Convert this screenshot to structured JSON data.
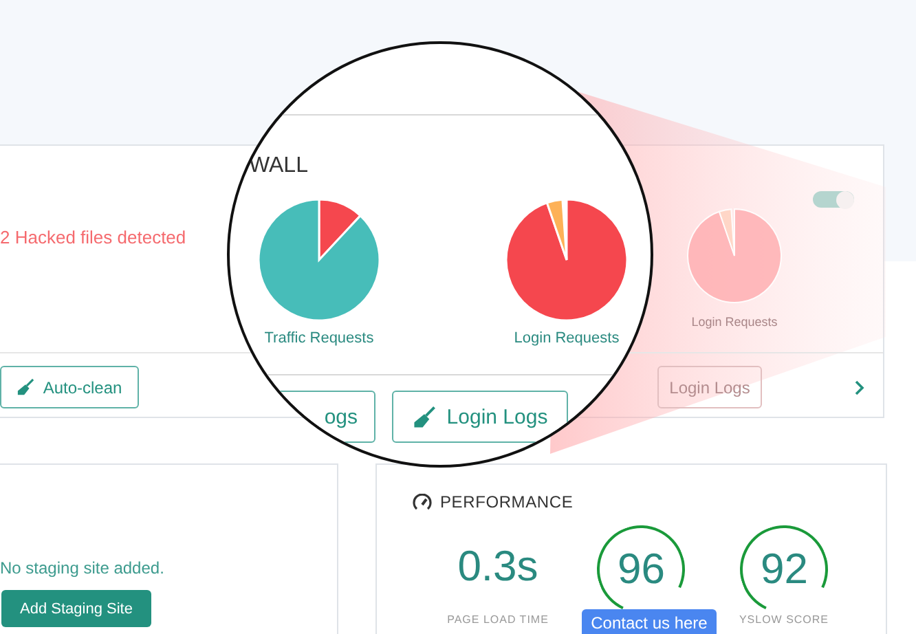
{
  "firewall_card": {
    "alert": "2 Hacked files detected",
    "auto_clean_button": "Auto-clean",
    "toggle": {
      "on": true
    },
    "small_chart_label": "Login Requests",
    "small_logs_button": "Login Logs"
  },
  "magnifier": {
    "title": "WALL",
    "charts": [
      {
        "kind": "traffic",
        "label": "Traffic Requests"
      },
      {
        "kind": "login",
        "label": "Login Requests"
      }
    ],
    "buttons": [
      "ogs",
      "Login Logs"
    ]
  },
  "staging_card": {
    "message": "No staging site added.",
    "button": "Add Staging Site"
  },
  "performance_card": {
    "title": "PERFORMANCE",
    "metrics": [
      {
        "kind": "time",
        "value": "0.3s",
        "label": "PAGE LOAD TIME"
      },
      {
        "kind": "score",
        "value": "96"
      },
      {
        "kind": "score",
        "value": "92",
        "label": "YSLOW SCORE"
      }
    ]
  },
  "contact_button": "Contact us here"
}
